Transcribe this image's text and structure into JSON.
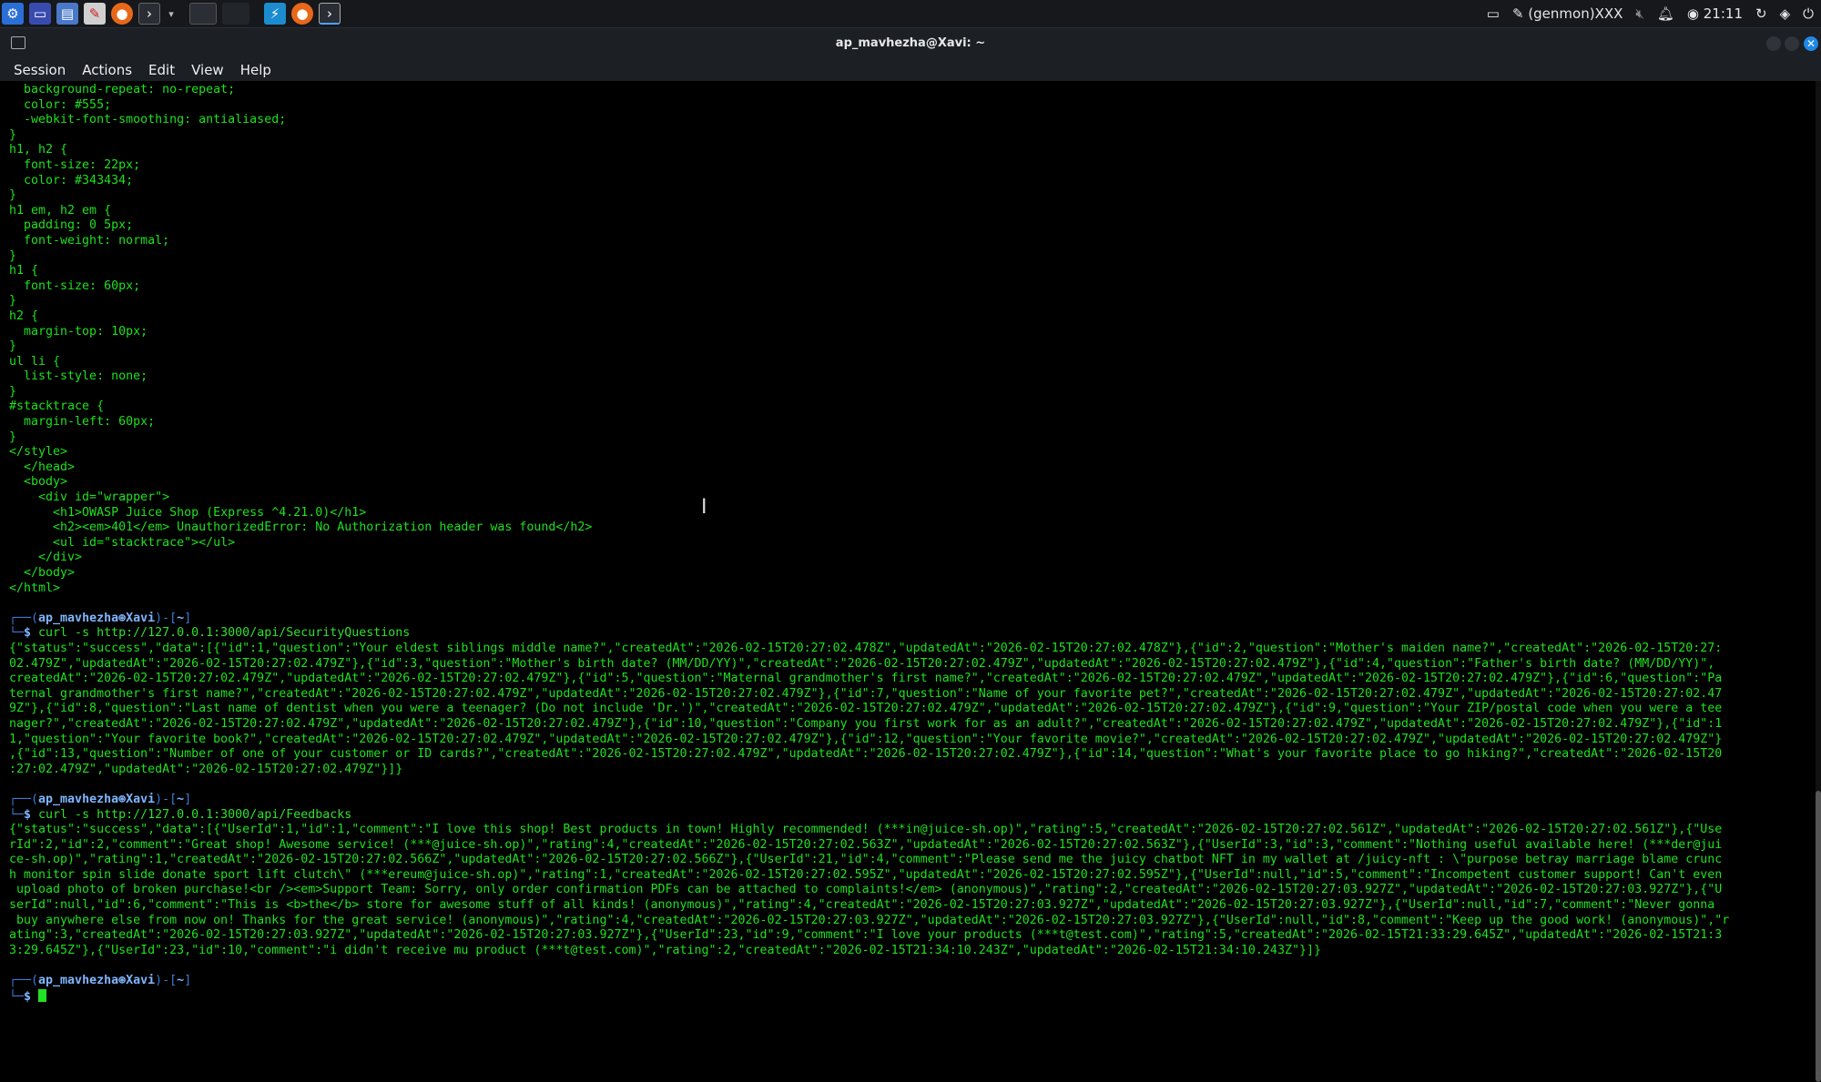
{
  "panel": {
    "user_label": "(genmon)XXX",
    "clock": "21:11"
  },
  "window": {
    "title": "ap_mavhezha@Xavi: ~"
  },
  "menubar": [
    "Session",
    "Actions",
    "Edit",
    "View",
    "Help"
  ],
  "terminal": {
    "prompt_user": "ap_mavhezha",
    "prompt_at": "⊛",
    "prompt_host": "Xavi",
    "prompt_dir": "~",
    "lines": [
      "  background-repeat: no-repeat;",
      "  color: #555;",
      "  -webkit-font-smoothing: antialiased;",
      "}",
      "h1, h2 {",
      "  font-size: 22px;",
      "  color: #343434;",
      "}",
      "h1 em, h2 em {",
      "  padding: 0 5px;",
      "  font-weight: normal;",
      "}",
      "h1 {",
      "  font-size: 60px;",
      "}",
      "h2 {",
      "  margin-top: 10px;",
      "}",
      "ul li {",
      "  list-style: none;",
      "}",
      "#stacktrace {",
      "  margin-left: 60px;",
      "}",
      "</style>",
      "  </head>",
      "  <body>",
      "    <div id=\"wrapper\">",
      "      <h1>OWASP Juice Shop (Express ^4.21.0)</h1>",
      "      <h2><em>401</em> UnauthorizedError: No Authorization header was found</h2>",
      "      <ul id=\"stacktrace\"></ul>",
      "    </div>",
      "  </body>",
      "</html>"
    ],
    "cmd1": "curl -s http://127.0.0.1:3000/api/SecurityQuestions",
    "out1": [
      "{\"status\":\"success\",\"data\":[{\"id\":1,\"question\":\"Your eldest siblings middle name?\",\"createdAt\":\"2026-02-15T20:27:02.478Z\",\"updatedAt\":\"2026-02-15T20:27:02.478Z\"},{\"id\":2,\"question\":\"Mother's maiden name?\",\"createdAt\":\"2026-02-15T20:27:",
      "02.479Z\",\"updatedAt\":\"2026-02-15T20:27:02.479Z\"},{\"id\":3,\"question\":\"Mother's birth date? (MM/DD/YY)\",\"createdAt\":\"2026-02-15T20:27:02.479Z\",\"updatedAt\":\"2026-02-15T20:27:02.479Z\"},{\"id\":4,\"question\":\"Father's birth date? (MM/DD/YY)\",",
      "createdAt\":\"2026-02-15T20:27:02.479Z\",\"updatedAt\":\"2026-02-15T20:27:02.479Z\"},{\"id\":5,\"question\":\"Maternal grandmother's first name?\",\"createdAt\":\"2026-02-15T20:27:02.479Z\",\"updatedAt\":\"2026-02-15T20:27:02.479Z\"},{\"id\":6,\"question\":\"Pa",
      "ternal grandmother's first name?\",\"createdAt\":\"2026-02-15T20:27:02.479Z\",\"updatedAt\":\"2026-02-15T20:27:02.479Z\"},{\"id\":7,\"question\":\"Name of your favorite pet?\",\"createdAt\":\"2026-02-15T20:27:02.479Z\",\"updatedAt\":\"2026-02-15T20:27:02.47",
      "9Z\"},{\"id\":8,\"question\":\"Last name of dentist when you were a teenager? (Do not include 'Dr.')\",\"createdAt\":\"2026-02-15T20:27:02.479Z\",\"updatedAt\":\"2026-02-15T20:27:02.479Z\"},{\"id\":9,\"question\":\"Your ZIP/postal code when you were a tee",
      "nager?\",\"createdAt\":\"2026-02-15T20:27:02.479Z\",\"updatedAt\":\"2026-02-15T20:27:02.479Z\"},{\"id\":10,\"question\":\"Company you first work for as an adult?\",\"createdAt\":\"2026-02-15T20:27:02.479Z\",\"updatedAt\":\"2026-02-15T20:27:02.479Z\"},{\"id\":1",
      "1,\"question\":\"Your favorite book?\",\"createdAt\":\"2026-02-15T20:27:02.479Z\",\"updatedAt\":\"2026-02-15T20:27:02.479Z\"},{\"id\":12,\"question\":\"Your favorite movie?\",\"createdAt\":\"2026-02-15T20:27:02.479Z\",\"updatedAt\":\"2026-02-15T20:27:02.479Z\"}",
      ",{\"id\":13,\"question\":\"Number of one of your customer or ID cards?\",\"createdAt\":\"2026-02-15T20:27:02.479Z\",\"updatedAt\":\"2026-02-15T20:27:02.479Z\"},{\"id\":14,\"question\":\"What's your favorite place to go hiking?\",\"createdAt\":\"2026-02-15T20",
      ":27:02.479Z\",\"updatedAt\":\"2026-02-15T20:27:02.479Z\"}]}"
    ],
    "cmd2": "curl -s http://127.0.0.1:3000/api/Feedbacks",
    "out2": [
      "{\"status\":\"success\",\"data\":[{\"UserId\":1,\"id\":1,\"comment\":\"I love this shop! Best products in town! Highly recommended! (***in@juice-sh.op)\",\"rating\":5,\"createdAt\":\"2026-02-15T20:27:02.561Z\",\"updatedAt\":\"2026-02-15T20:27:02.561Z\"},{\"Use",
      "rId\":2,\"id\":2,\"comment\":\"Great shop! Awesome service! (***@juice-sh.op)\",\"rating\":4,\"createdAt\":\"2026-02-15T20:27:02.563Z\",\"updatedAt\":\"2026-02-15T20:27:02.563Z\"},{\"UserId\":3,\"id\":3,\"comment\":\"Nothing useful available here! (***der@jui",
      "ce-sh.op)\",\"rating\":1,\"createdAt\":\"2026-02-15T20:27:02.566Z\",\"updatedAt\":\"2026-02-15T20:27:02.566Z\"},{\"UserId\":21,\"id\":4,\"comment\":\"Please send me the juicy chatbot NFT in my wallet at /juicy-nft : \\\"purpose betray marriage blame crunc",
      "h monitor spin slide donate sport lift clutch\\\" (***ereum@juice-sh.op)\",\"rating\":1,\"createdAt\":\"2026-02-15T20:27:02.595Z\",\"updatedAt\":\"2026-02-15T20:27:02.595Z\"},{\"UserId\":null,\"id\":5,\"comment\":\"Incompetent customer support! Can't even",
      " upload photo of broken purchase!<br /><em>Support Team: Sorry, only order confirmation PDFs can be attached to complaints!</em> (anonymous)\",\"rating\":2,\"createdAt\":\"2026-02-15T20:27:03.927Z\",\"updatedAt\":\"2026-02-15T20:27:03.927Z\"},{\"U",
      "serId\":null,\"id\":6,\"comment\":\"This is <b>the</b> store for awesome stuff of all kinds! (anonymous)\",\"rating\":4,\"createdAt\":\"2026-02-15T20:27:03.927Z\",\"updatedAt\":\"2026-02-15T20:27:03.927Z\"},{\"UserId\":null,\"id\":7,\"comment\":\"Never gonna",
      " buy anywhere else from now on! Thanks for the great service! (anonymous)\",\"rating\":4,\"createdAt\":\"2026-02-15T20:27:03.927Z\",\"updatedAt\":\"2026-02-15T20:27:03.927Z\"},{\"UserId\":null,\"id\":8,\"comment\":\"Keep up the good work! (anonymous)\",\"r",
      "ating\":3,\"createdAt\":\"2026-02-15T20:27:03.927Z\",\"updatedAt\":\"2026-02-15T20:27:03.927Z\"},{\"UserId\":23,\"id\":9,\"comment\":\"I love your products (***t@test.com)\",\"rating\":5,\"createdAt\":\"2026-02-15T21:33:29.645Z\",\"updatedAt\":\"2026-02-15T21:3",
      "3:29.645Z\"},{\"UserId\":23,\"id\":10,\"comment\":\"i didn't receive mu product (***t@test.com)\",\"rating\":2,\"createdAt\":\"2026-02-15T21:34:10.243Z\",\"updatedAt\":\"2026-02-15T21:34:10.243Z\"}]}"
    ]
  }
}
